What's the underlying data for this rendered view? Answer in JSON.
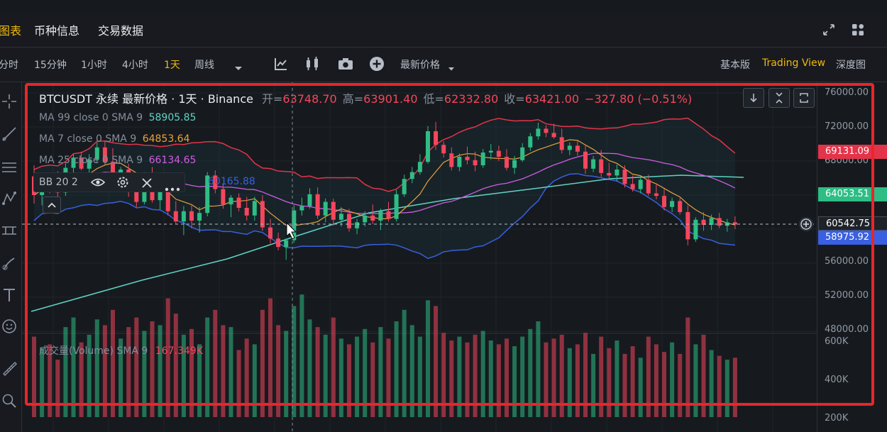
{
  "tabs": {
    "chart": "图表",
    "coin_info": "币种信息",
    "trade_data": "交易数据"
  },
  "toolbar": {
    "intervals": [
      "分时",
      "15分钟",
      "1小时",
      "4小时",
      "1天",
      "周线"
    ],
    "active_interval": "1天",
    "price_type": "最新价格",
    "view_basic": "基本版",
    "view_tv": "Trading View",
    "view_depth": "深度图"
  },
  "header": {
    "symbol": "BTCUSDT 永续 最新价格 · 1天 · Binance",
    "open_label": "开=",
    "open": "63748.70",
    "high_label": "高=",
    "high": "63901.40",
    "low_label": "低=",
    "low": "62332.80",
    "close_label": "收=",
    "close": "63421.00",
    "change": "−327.80 (−0.51%)"
  },
  "legends": {
    "ma99": {
      "label": "MA 99 close 0 SMA 9",
      "value": "58905.85"
    },
    "ma7": {
      "label": "MA 7 close 0 SMA 9",
      "value": "64853.64"
    },
    "ma25": {
      "label": "MA 25 close 0 SMA 9",
      "value": "66134.65"
    },
    "bb": {
      "label": "BB 20 2",
      "value": "60165.88"
    },
    "volume": {
      "label": "成交量(Volume) SMA 9",
      "value": "167.349K"
    }
  },
  "yaxis": {
    "price_ticks": [
      "76000.00",
      "72000.00",
      "68000.00",
      "56000.00",
      "52000.00",
      "48000.00"
    ],
    "volume_ticks": [
      "600K",
      "400K",
      "200K"
    ],
    "tags": {
      "bb_upper": "69131.09",
      "ma7_tag": "64053.51",
      "last_price": "60542.75",
      "bb_lower": "58975.92"
    }
  },
  "colors": {
    "up": "#2ebd85",
    "down": "#f6465d",
    "ma99": "#5fd3c6",
    "ma7": "#e9a23b",
    "ma25": "#d05ce3",
    "bb": "#3a5fe0",
    "bb_upper": "#e4344a",
    "accent": "#f0b90b",
    "highlight": "#e8262a"
  },
  "icons": {
    "expand": "expand-icon",
    "grid": "grid-icon",
    "indicator": "indicator-icon",
    "candle": "candlestick-icon",
    "camera": "camera-icon",
    "add": "add-icon"
  },
  "chart_data": {
    "type": "candlestick",
    "title": "BTCUSDT 永续 最新价格 · 1天 · Binance",
    "ylim": [
      48000,
      76000
    ],
    "candles": [
      [
        66200,
        67500,
        63000,
        64000
      ],
      [
        64000,
        65600,
        62800,
        65200
      ],
      [
        65200,
        66400,
        64200,
        65000
      ],
      [
        65000,
        66800,
        63800,
        64300
      ],
      [
        64300,
        67700,
        63900,
        67200
      ],
      [
        67200,
        68800,
        66500,
        68400
      ],
      [
        68400,
        69100,
        66900,
        67100
      ],
      [
        67100,
        68800,
        66400,
        68200
      ],
      [
        68200,
        70200,
        67800,
        69600
      ],
      [
        69600,
        70400,
        67600,
        67900
      ],
      [
        67900,
        69500,
        65300,
        65900
      ],
      [
        65900,
        67300,
        65000,
        67000
      ],
      [
        67000,
        67700,
        63800,
        64400
      ],
      [
        64400,
        65500,
        62600,
        63200
      ],
      [
        63200,
        66700,
        62900,
        66200
      ],
      [
        66200,
        67300,
        63100,
        63400
      ],
      [
        63400,
        64800,
        62300,
        64500
      ],
      [
        64500,
        65900,
        61600,
        62100
      ],
      [
        62100,
        63300,
        60600,
        60900
      ],
      [
        60900,
        62700,
        59300,
        62100
      ],
      [
        62100,
        62900,
        60100,
        61000
      ],
      [
        61000,
        62600,
        59600,
        61900
      ],
      [
        61900,
        66700,
        61500,
        66300
      ],
      [
        66300,
        66900,
        64200,
        64700
      ],
      [
        64700,
        65300,
        62400,
        62900
      ],
      [
        62900,
        64000,
        61400,
        63700
      ],
      [
        63700,
        64200,
        62100,
        62500
      ],
      [
        62500,
        63800,
        61000,
        61600
      ],
      [
        61600,
        63800,
        61000,
        63300
      ],
      [
        63300,
        64000,
        59800,
        60200
      ],
      [
        60200,
        61200,
        58300,
        58900
      ],
      [
        58900,
        59600,
        57500,
        57900
      ],
      [
        57900,
        58900,
        56400,
        58700
      ],
      [
        58700,
        62800,
        58400,
        62200
      ],
      [
        62200,
        63700,
        61600,
        62700
      ],
      [
        62700,
        64800,
        62400,
        64100
      ],
      [
        64100,
        64900,
        61200,
        61600
      ],
      [
        61600,
        63600,
        60800,
        63200
      ],
      [
        63200,
        63600,
        60400,
        61100
      ],
      [
        61100,
        62600,
        60300,
        61800
      ],
      [
        61800,
        62400,
        59700,
        60100
      ],
      [
        60100,
        61200,
        59400,
        60800
      ],
      [
        60800,
        62100,
        60300,
        61600
      ],
      [
        61600,
        62900,
        60600,
        61000
      ],
      [
        61000,
        62400,
        59900,
        62100
      ],
      [
        62100,
        63200,
        60900,
        61200
      ],
      [
        61200,
        64600,
        60900,
        64100
      ],
      [
        64100,
        66400,
        63800,
        65900
      ],
      [
        65900,
        67300,
        65400,
        66700
      ],
      [
        66700,
        68800,
        66400,
        67900
      ],
      [
        67900,
        72100,
        67700,
        71500
      ],
      [
        71500,
        72600,
        69300,
        69900
      ],
      [
        69900,
        70300,
        68400,
        68900
      ],
      [
        68900,
        69600,
        66900,
        67300
      ],
      [
        67300,
        68900,
        66800,
        68500
      ],
      [
        68500,
        69700,
        67600,
        68100
      ],
      [
        68100,
        69100,
        66800,
        67500
      ],
      [
        67500,
        69400,
        67200,
        69000
      ],
      [
        69000,
        70000,
        68200,
        69200
      ],
      [
        69200,
        69800,
        68000,
        68500
      ],
      [
        68500,
        69400,
        66900,
        67200
      ],
      [
        67200,
        68600,
        66500,
        68100
      ],
      [
        68100,
        70100,
        67900,
        69600
      ],
      [
        69600,
        71300,
        69200,
        70900
      ],
      [
        70900,
        72500,
        70500,
        71800
      ],
      [
        71800,
        72200,
        70800,
        71300
      ],
      [
        71300,
        72400,
        70600,
        70800
      ],
      [
        70800,
        71800,
        68900,
        69300
      ],
      [
        69300,
        70200,
        68700,
        69800
      ],
      [
        69800,
        70400,
        68600,
        69100
      ],
      [
        69100,
        69800,
        66500,
        67100
      ],
      [
        67100,
        68600,
        66700,
        68200
      ],
      [
        68200,
        69300,
        66100,
        66600
      ],
      [
        66600,
        67800,
        65800,
        66300
      ],
      [
        66300,
        67600,
        65600,
        67000
      ],
      [
        67000,
        67500,
        64900,
        65300
      ],
      [
        65300,
        66300,
        64400,
        64700
      ],
      [
        64700,
        66200,
        64200,
        65800
      ],
      [
        65800,
        66400,
        63900,
        64200
      ],
      [
        64200,
        65400,
        63500,
        63900
      ],
      [
        63900,
        64700,
        62200,
        62600
      ],
      [
        62600,
        63700,
        62000,
        63300
      ],
      [
        63300,
        63800,
        61700,
        62000
      ],
      [
        62000,
        62800,
        58100,
        58800
      ],
      [
        58800,
        61400,
        58500,
        61100
      ],
      [
        61100,
        62000,
        59800,
        60500
      ],
      [
        60500,
        61700,
        59900,
        61300
      ],
      [
        61300,
        61900,
        60100,
        60400
      ],
      [
        60400,
        61200,
        59700,
        60800
      ],
      [
        60800,
        61500,
        60000,
        60543
      ]
    ],
    "volumes_k": [
      420,
      360,
      380,
      300,
      470,
      520,
      390,
      430,
      510,
      480,
      560,
      410,
      470,
      520,
      450,
      500,
      480,
      620,
      540,
      430,
      460,
      380,
      520,
      560,
      480,
      470,
      350,
      410,
      380,
      560,
      620,
      480,
      450,
      580,
      640,
      510,
      470,
      430,
      520,
      410,
      380,
      420,
      460,
      390,
      470,
      410,
      500,
      560,
      480,
      420,
      610,
      580,
      440,
      400,
      420,
      390,
      430,
      450,
      400,
      380,
      410,
      370,
      420,
      460,
      500,
      390,
      410,
      430,
      360,
      380,
      440,
      330,
      420,
      360,
      400,
      330,
      370,
      310,
      420,
      380,
      340,
      390,
      330,
      520,
      380,
      430,
      350,
      320,
      300,
      310
    ]
  }
}
